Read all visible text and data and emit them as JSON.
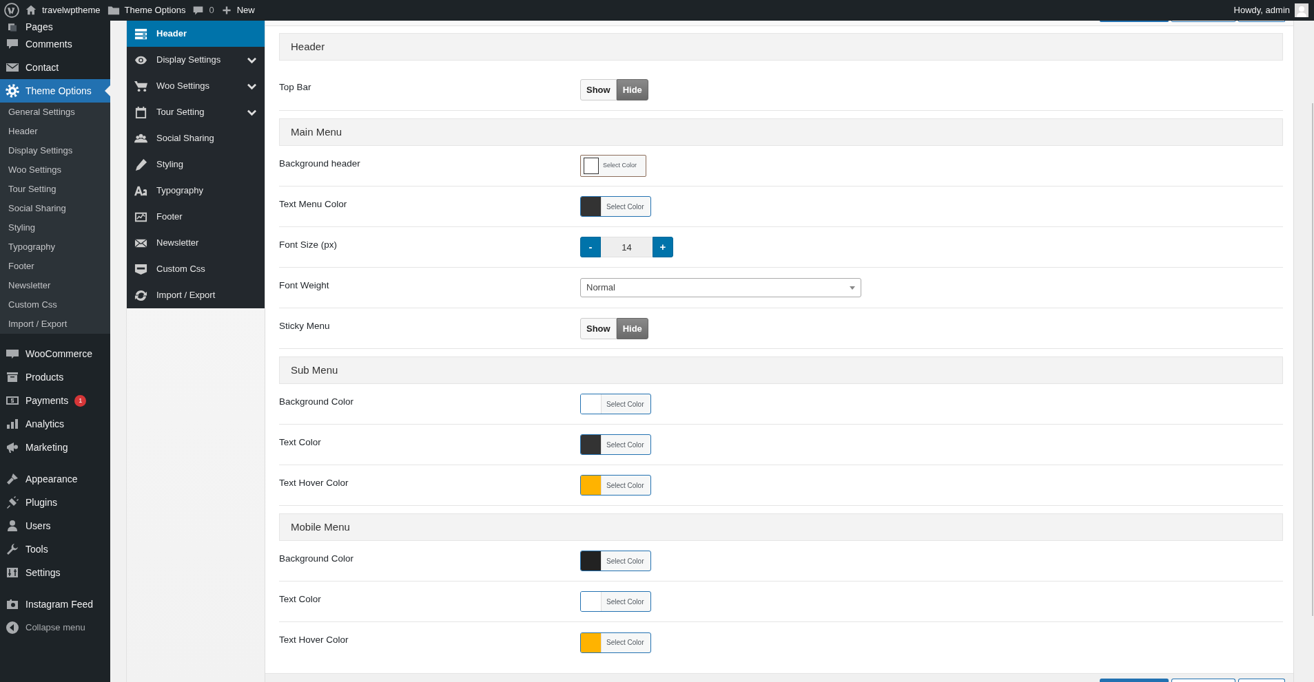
{
  "admin_bar": {
    "site": "travelwptheme",
    "section": "Theme Options",
    "comments": "0",
    "new": "New",
    "greeting": "Howdy, admin"
  },
  "sidebar": {
    "items": [
      {
        "label": "Pages",
        "selected": false,
        "gap_before": false
      },
      {
        "label": "Comments",
        "selected": false,
        "gap_before": false
      },
      {
        "label": "Contact",
        "selected": false,
        "gap_before": false
      },
      {
        "label": "Theme Options",
        "selected": true,
        "gap_before": false,
        "children": [
          {
            "label": "General Settings",
            "selected": false
          },
          {
            "label": "Header",
            "selected": false
          },
          {
            "label": "Display Settings",
            "selected": false
          },
          {
            "label": "Woo Settings",
            "selected": false
          },
          {
            "label": "Tour Setting",
            "selected": false
          },
          {
            "label": "Social Sharing",
            "selected": false
          },
          {
            "label": "Styling",
            "selected": false
          },
          {
            "label": "Typography",
            "selected": false
          },
          {
            "label": "Footer",
            "selected": false
          },
          {
            "label": "Newsletter",
            "selected": false
          },
          {
            "label": "Custom Css",
            "selected": false
          },
          {
            "label": "Import / Export",
            "selected": false
          }
        ]
      },
      {
        "label": "WooCommerce",
        "selected": false,
        "gap_before": true
      },
      {
        "label": "Products",
        "selected": false,
        "gap_before": false
      },
      {
        "label": "Payments",
        "selected": false,
        "gap_before": false,
        "badge": "1"
      },
      {
        "label": "Analytics",
        "selected": false,
        "gap_before": false
      },
      {
        "label": "Marketing",
        "selected": false,
        "gap_before": false
      },
      {
        "label": "Appearance",
        "selected": false,
        "gap_before": true
      },
      {
        "label": "Plugins",
        "selected": false,
        "gap_before": false
      },
      {
        "label": "Users",
        "selected": false,
        "gap_before": false
      },
      {
        "label": "Tools",
        "selected": false,
        "gap_before": false
      },
      {
        "label": "Settings",
        "selected": false,
        "gap_before": false
      },
      {
        "label": "Instagram Feed",
        "selected": false,
        "gap_before": true
      }
    ],
    "collapse": "Collapse menu"
  },
  "options_nav": [
    {
      "label": "Header",
      "selected": true,
      "expandable": false
    },
    {
      "label": "Display Settings",
      "selected": false,
      "expandable": true
    },
    {
      "label": "Woo Settings",
      "selected": false,
      "expandable": true
    },
    {
      "label": "Tour Setting",
      "selected": false,
      "expandable": true
    },
    {
      "label": "Social Sharing",
      "selected": false,
      "expandable": false
    },
    {
      "label": "Styling",
      "selected": false,
      "expandable": false
    },
    {
      "label": "Typography",
      "selected": false,
      "expandable": false
    },
    {
      "label": "Footer",
      "selected": false,
      "expandable": false
    },
    {
      "label": "Newsletter",
      "selected": false,
      "expandable": false
    },
    {
      "label": "Custom Css",
      "selected": false,
      "expandable": false
    },
    {
      "label": "Import / Export",
      "selected": false,
      "expandable": false
    }
  ],
  "sections": [
    {
      "title": "Header",
      "fields": [
        {
          "label": "Top Bar",
          "kind": "toggle",
          "options": [
            {
              "label": "Show",
              "selected": false
            },
            {
              "label": "Hide",
              "selected": true
            }
          ]
        }
      ]
    },
    {
      "title": "Main Menu",
      "fields": [
        {
          "label": "Background header",
          "kind": "color",
          "color": "#ffffff",
          "button": "Select Color",
          "focused": true
        },
        {
          "label": "Text Menu Color",
          "kind": "color",
          "color": "#333333",
          "button": "Select Color",
          "focused": false
        },
        {
          "label": "Font Size (px)",
          "kind": "number",
          "value": "14",
          "decrement": "-",
          "increment": "+"
        },
        {
          "label": "Font Weight",
          "kind": "select",
          "value": "Normal"
        },
        {
          "label": "Sticky Menu",
          "kind": "toggle",
          "options": [
            {
              "label": "Show",
              "selected": false
            },
            {
              "label": "Hide",
              "selected": true
            }
          ]
        }
      ]
    },
    {
      "title": "Sub Menu",
      "fields": [
        {
          "label": "Background Color",
          "kind": "color",
          "color": "#ffffff",
          "button": "Select Color",
          "focused": false
        },
        {
          "label": "Text Color",
          "kind": "color",
          "color": "#333333",
          "button": "Select Color",
          "focused": false
        },
        {
          "label": "Text Hover Color",
          "kind": "color",
          "color": "#ffb300",
          "button": "Select Color",
          "focused": false
        }
      ]
    },
    {
      "title": "Mobile Menu",
      "fields": [
        {
          "label": "Background Color",
          "kind": "color",
          "color": "#222222",
          "button": "Select Color",
          "focused": false
        },
        {
          "label": "Text Color",
          "kind": "color",
          "color": "#ffffff",
          "button": "Select Color",
          "focused": false
        },
        {
          "label": "Text Hover Color",
          "kind": "color",
          "color": "#ffb300",
          "button": "Select Color",
          "focused": false
        }
      ]
    }
  ]
}
